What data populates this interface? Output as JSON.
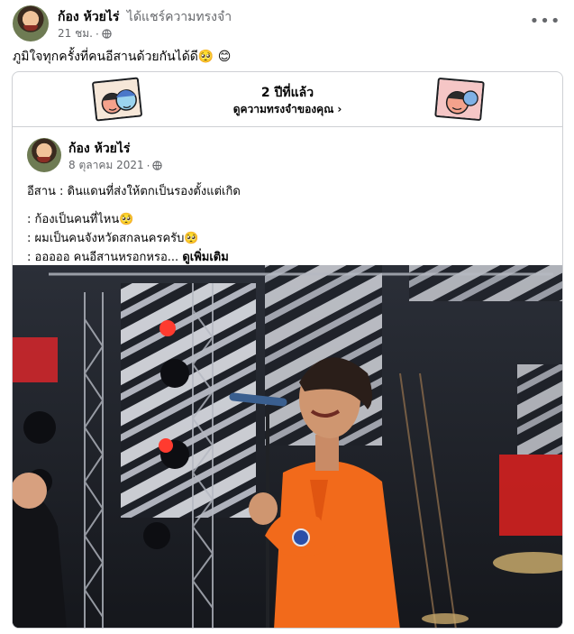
{
  "post": {
    "author_name": "ก้อง ห้วยไร่",
    "action_text": "ได้แชร์ความทรงจำ",
    "time": "21 ชม.",
    "separator": "·",
    "text": "ภูมิใจทุกครั้งที่คนอีสานด้วยกันได้ดี🥺 😊"
  },
  "memory": {
    "years_ago": "2 ปีที่แล้ว",
    "see_memories_label": "ดูความทรงจำของคุณ",
    "chevron": "›"
  },
  "shared_post": {
    "author_name": "ก้อง ห้วยไร่",
    "date": "8 ตุลาคม 2021",
    "separator": "·",
    "lines": [
      "อีสาน : ดินแดนที่ส่งให้ตกเป็นรองตั้งแต่เกิด",
      ": ก้องเป็นคนที่ไหน🥺",
      ": ผมเป็นคนจังหวัดสกลนครครับ🥺",
      ": อออออ คนอีสานหรอกหรอ..."
    ],
    "see_more_label": "ดูเพิ่มเติม"
  },
  "icons": {
    "more": "more-options-icon",
    "globe": "globe-icon",
    "chevron": "chevron-right-icon"
  },
  "colors": {
    "text_primary": "#050505",
    "text_secondary": "#65676b",
    "border": "#ced0d4",
    "shirt_orange": "#f26a1b"
  }
}
